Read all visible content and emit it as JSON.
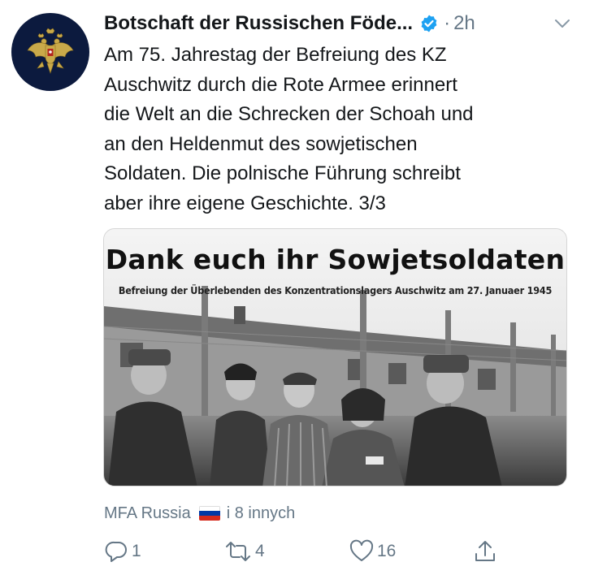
{
  "account": {
    "name": "Botschaft der Russischen Föde...",
    "verified_icon": "verified-badge-icon",
    "separator": "·",
    "time": "2h",
    "avatar_icon": "double-headed-eagle-emblem"
  },
  "tweet": {
    "text": "Am 75. Jahrestag der Befreiung des KZ\nAuschwitz durch die Rote Armee erinnert\ndie Welt an die Schrecken der Schoah und\nan den Heldenmut des sowjetischen\nSoldaten. Die polnische Führung schreibt\naber ihre eigene Geschichte. 3/3"
  },
  "media": {
    "title": "Dank euch ihr Sowjetsoldaten",
    "caption": "Befreiung der Überlebenden des Konzentrationslagers Auschwitz am 27. Januaer 1945"
  },
  "social_context": {
    "liked_by": "MFA Russia",
    "flag_icon": "russia-flag-icon",
    "others": "i 8 innych"
  },
  "actions": {
    "reply_count": "1",
    "retweet_count": "4",
    "like_count": "16",
    "share_icon": "share-icon"
  },
  "colors": {
    "text": "#14171a",
    "secondary": "#657786",
    "verified": "#1da1f2",
    "avatar_bg": "#0c1a3e"
  }
}
